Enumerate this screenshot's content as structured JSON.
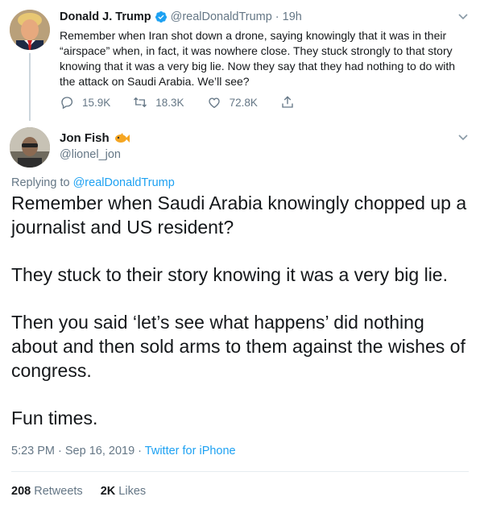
{
  "parent_tweet": {
    "name": "Donald J. Trump",
    "handle": "@realDonaldTrump",
    "time": "· 19h",
    "text": "Remember when Iran shot down a drone, saying knowingly that it was in their “airspace” when, in fact, it was nowhere close. They stuck strongly to that story knowing that it was a very big lie. Now they say that they had nothing to do with the attack on Saudi Arabia. We’ll see?",
    "replies": "15.9K",
    "retweets": "18.3K",
    "likes": "72.8K"
  },
  "reply_tweet": {
    "name": "Jon Fish",
    "handle": "@lionel_jon",
    "replying_prefix": "Replying to",
    "replying_to": "@realDonaldTrump",
    "paragraphs": [
      "Remember when Saudi Arabia knowingly chopped up a journalist and US resident?",
      "They stuck to their story knowing it was a very big lie.",
      "Then you said ‘let’s see what happens’ did nothing about and then sold arms to them against the wishes of congress.",
      "Fun times."
    ],
    "timestamp": "5:23 PM · Sep 16, 2019 ·",
    "source": "Twitter for iPhone",
    "retweet_count": "208",
    "retweet_label": "Retweets",
    "like_count": "2K",
    "like_label": "Likes"
  },
  "colors": {
    "accent": "#1da1f2",
    "muted": "#657786",
    "text": "#14171a",
    "divider": "#e6ecf0"
  },
  "icons": [
    "verified-badge-icon",
    "reply-icon",
    "retweet-icon",
    "like-icon",
    "share-icon",
    "chevron-down-icon",
    "fish-emoji-icon"
  ]
}
